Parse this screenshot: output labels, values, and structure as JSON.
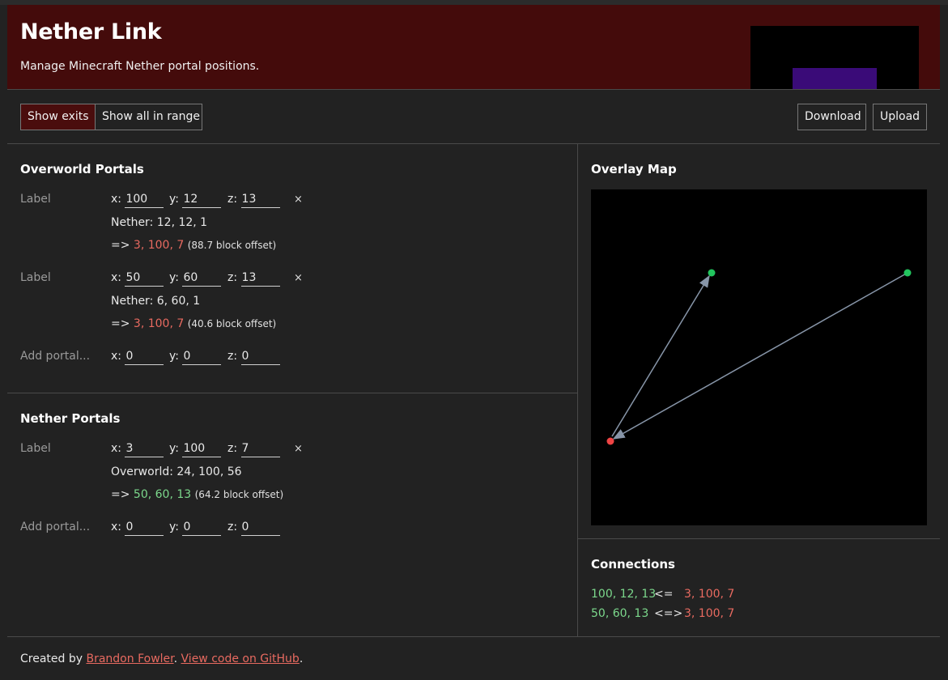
{
  "header": {
    "title": "Nether Link",
    "subtitle": "Manage Minecraft Nether portal positions."
  },
  "toolbar": {
    "show_exits": "Show exits",
    "show_all": "Show all in range",
    "download": "Download",
    "upload": "Upload"
  },
  "overworld": {
    "heading": "Overworld Portals",
    "portals": [
      {
        "label": "Label",
        "x": "100",
        "y": "12",
        "z": "13",
        "converted_prefix": "Nether: ",
        "converted": "12, 12, 1",
        "arrow": "=> ",
        "target": "3, 100, 7",
        "offset": "(88.7 block offset)"
      },
      {
        "label": "Label",
        "x": "50",
        "y": "60",
        "z": "13",
        "converted_prefix": "Nether: ",
        "converted": "6, 60, 1",
        "arrow": "=> ",
        "target": "3, 100, 7",
        "offset": "(40.6 block offset)"
      }
    ],
    "add": {
      "label": "Add portal...",
      "x": "0",
      "y": "0",
      "z": "0"
    }
  },
  "nether": {
    "heading": "Nether Portals",
    "portals": [
      {
        "label": "Label",
        "x": "3",
        "y": "100",
        "z": "7",
        "converted_prefix": "Overworld: ",
        "converted": "24, 100, 56",
        "arrow": "=> ",
        "target": "50, 60, 13",
        "offset": "(64.2 block offset)"
      }
    ],
    "add": {
      "label": "Add portal...",
      "x": "0",
      "y": "0",
      "z": "0"
    }
  },
  "coord_labels": {
    "x": "x:",
    "y": "y:",
    "z": "z:"
  },
  "delete_glyph": "×",
  "map": {
    "heading": "Overlay Map",
    "overworld_color": "#22c55e",
    "nether_color": "#ef4444",
    "link_color": "#8795a8"
  },
  "connections": {
    "heading": "Connections",
    "rows": [
      {
        "left": "100, 12, 13",
        "op": "<=",
        "right": "3, 100, 7"
      },
      {
        "left": "50, 60, 13",
        "op": "<=>",
        "right": "3, 100, 7"
      }
    ]
  },
  "footer": {
    "prefix": "Created by ",
    "author": "Brandon Fowler",
    "sep": ". ",
    "code_link": "View code on GitHub",
    "suffix": "."
  },
  "colors": {
    "header_bg": "#440b0b",
    "accent_red": "#e86a60",
    "accent_green": "#7cd88c",
    "background": "#222222"
  }
}
